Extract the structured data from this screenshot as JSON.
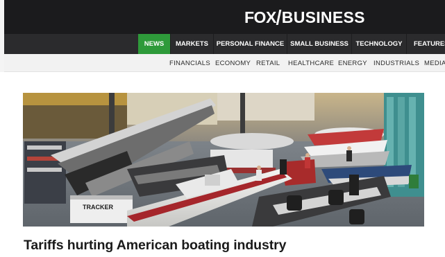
{
  "header": {
    "logo_fox": "FOX",
    "logo_business": "BUSINESS"
  },
  "nav": {
    "items": [
      {
        "label": "NEWS",
        "active": true
      },
      {
        "label": "MARKETS",
        "active": false
      },
      {
        "label": "PERSONAL FINANCE",
        "active": false
      },
      {
        "label": "SMALL BUSINESS",
        "active": false
      },
      {
        "label": "TECHNOLOGY",
        "active": false
      },
      {
        "label": "FEATURES",
        "active": false
      }
    ]
  },
  "subnav": {
    "items": [
      "FINANCIALS",
      "ECONOMY",
      "RETAIL",
      "HEALTHCARE",
      "ENERGY",
      "INDUSTRIALS",
      "MEDIA"
    ]
  },
  "article": {
    "headline": "Tariffs hurting American boating industry",
    "image_subject": "boat dealership showroom with boats on display",
    "image_sign_text": "TRACKER"
  },
  "colors": {
    "header_bg": "#1b1b1d",
    "nav_bg": "#2b2b2d",
    "nav_active": "#2e9a3a",
    "subnav_bg": "#f2f2f2"
  }
}
